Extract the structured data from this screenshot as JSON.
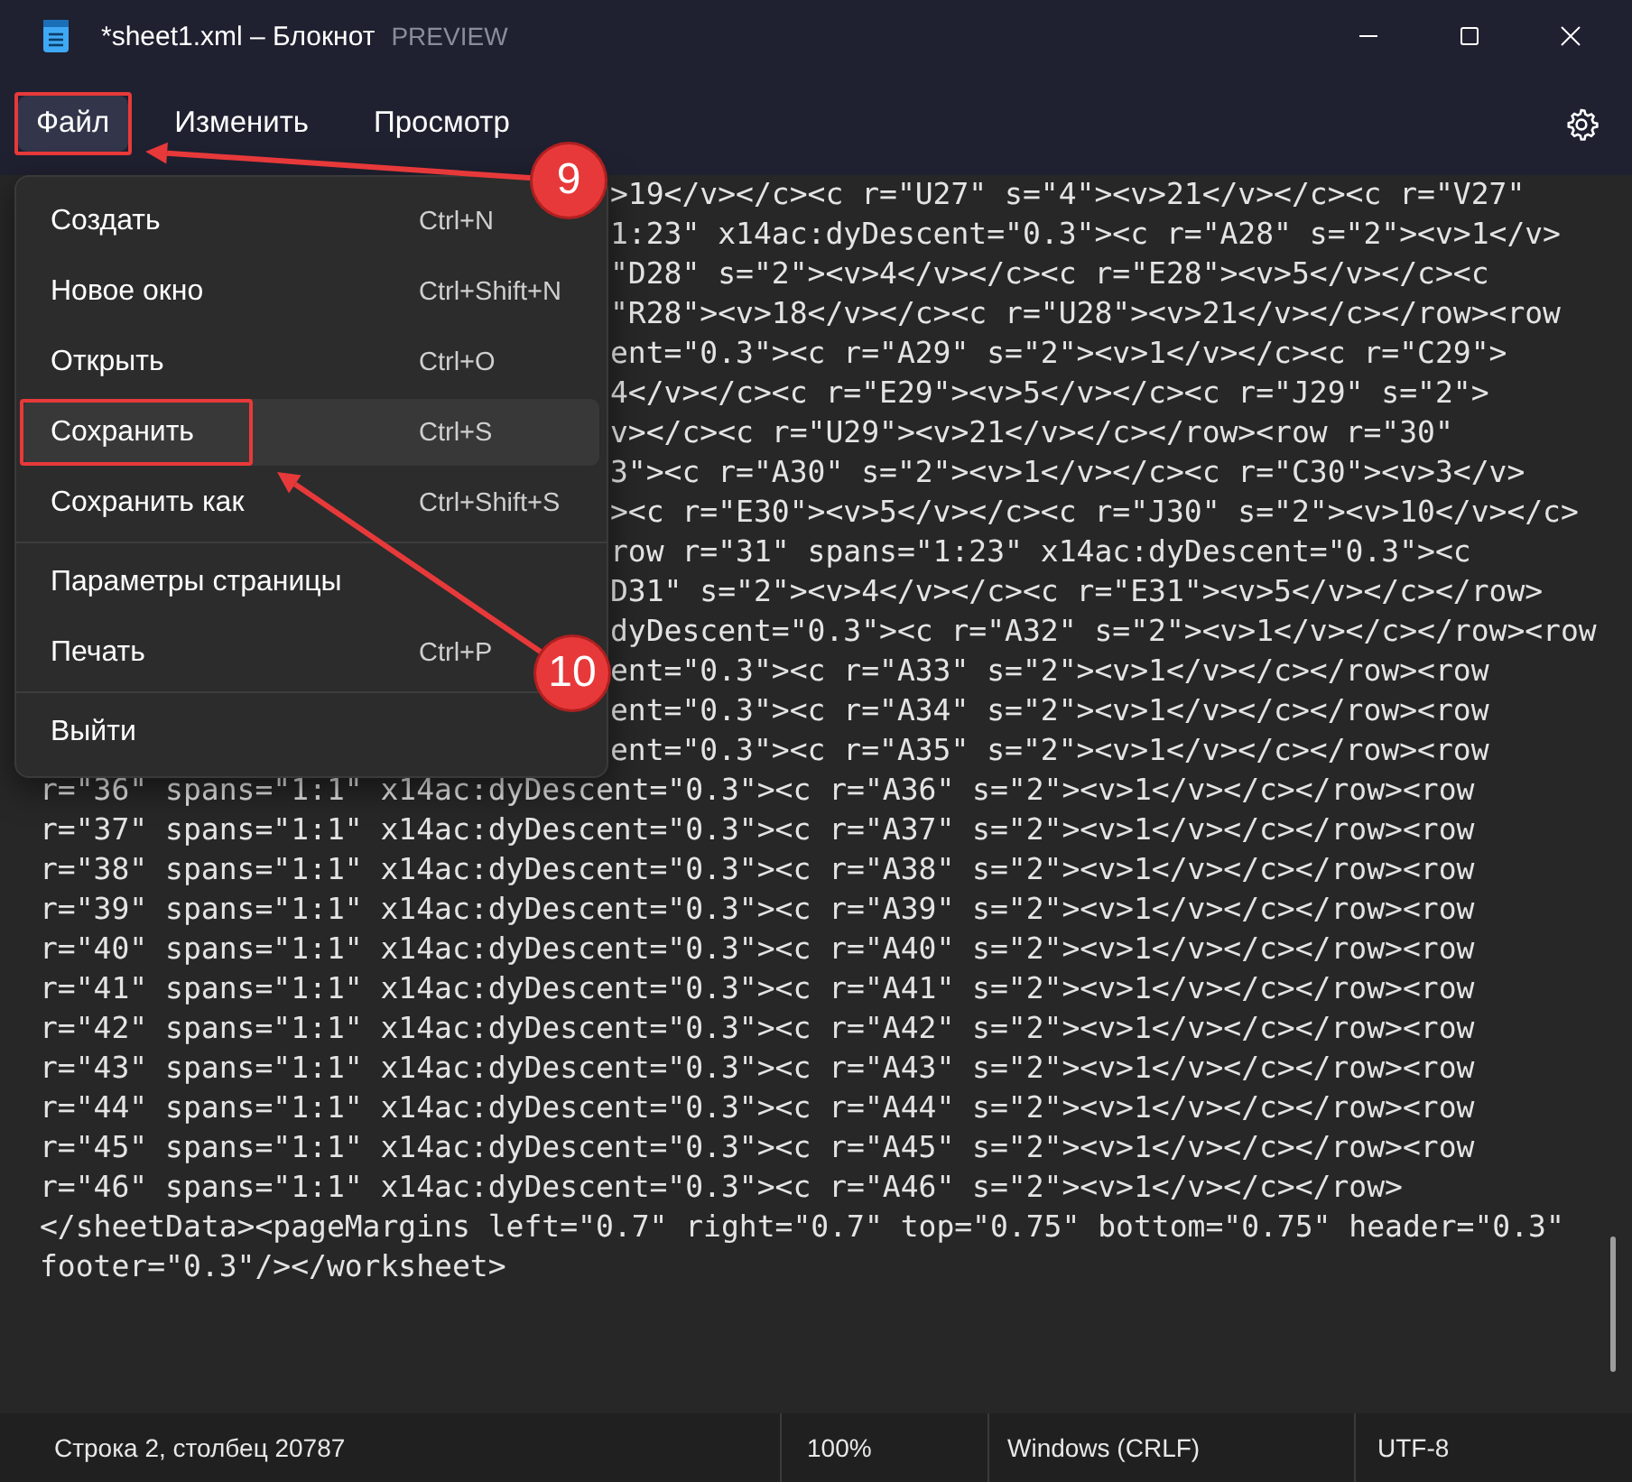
{
  "window": {
    "title": "*sheet1.xml – Блокнот",
    "badge": "PREVIEW"
  },
  "menu_bar": {
    "items": [
      {
        "label": "Файл",
        "selected": true,
        "annotation": "9"
      },
      {
        "label": "Изменить",
        "selected": false
      },
      {
        "label": "Просмотр",
        "selected": false
      }
    ]
  },
  "file_menu": {
    "items": [
      {
        "kind": "item",
        "label": "Создать",
        "shortcut": "Ctrl+N",
        "highlighted": false
      },
      {
        "kind": "item",
        "label": "Новое окно",
        "shortcut": "Ctrl+Shift+N",
        "highlighted": false
      },
      {
        "kind": "item",
        "label": "Открыть",
        "shortcut": "Ctrl+O",
        "highlighted": false
      },
      {
        "kind": "item",
        "label": "Сохранить",
        "shortcut": "Ctrl+S",
        "highlighted": true,
        "annotation": "10"
      },
      {
        "kind": "item",
        "label": "Сохранить как",
        "shortcut": "Ctrl+Shift+S",
        "highlighted": false
      },
      {
        "kind": "separator"
      },
      {
        "kind": "item",
        "label": "Параметры страницы",
        "highlighted": false
      },
      {
        "kind": "item",
        "label": "Печать",
        "shortcut": "Ctrl+P",
        "highlighted": false
      },
      {
        "kind": "separator"
      },
      {
        "kind": "item",
        "label": "Выйти",
        "highlighted": false
      }
    ]
  },
  "editor": {
    "lines_beside_menu": [
      ">19</v></c><c r=\"U27\" s=\"4\"><v>21</v></c><c r=\"V27\"",
      "1:23\" x14ac:dyDescent=\"0.3\"><c r=\"A28\" s=\"2\"><v>1</v>",
      "\"D28\" s=\"2\"><v>4</v></c><c r=\"E28\"><v>5</v></c><c",
      "\"R28\"><v>18</v></c><c r=\"U28\"><v>21</v></c></row><row",
      "ent=\"0.3\"><c r=\"A29\" s=\"2\"><v>1</v></c><c r=\"C29\">",
      "4</v></c><c r=\"E29\"><v>5</v></c><c r=\"J29\" s=\"2\">",
      "v></c><c r=\"U29\"><v>21</v></c></row><row r=\"30\"",
      "3\"><c r=\"A30\" s=\"2\"><v>1</v></c><c r=\"C30\"><v>3</v>",
      "><c r=\"E30\"><v>5</v></c><c r=\"J30\" s=\"2\"><v>10</v></c>",
      "row r=\"31\" spans=\"1:23\" x14ac:dyDescent=\"0.3\"><c",
      "D31\" s=\"2\"><v>4</v></c><c r=\"E31\"><v>5</v></c></row>",
      "dyDescent=\"0.3\"><c r=\"A32\" s=\"2\"><v>1</v></c></row><row",
      "ent=\"0.3\"><c r=\"A33\" s=\"2\"><v>1</v></c></row><row",
      "ent=\"0.3\"><c r=\"A34\" s=\"2\"><v>1</v></c></row><row",
      "ent=\"0.3\"><c r=\"A35\" s=\"2\"><v>1</v></c></row><row"
    ],
    "lines": [
      "r=\"36\" spans=\"1:1\" x14ac:dyDescent=\"0.3\"><c r=\"A36\" s=\"2\"><v>1</v></c></row><row",
      "r=\"37\" spans=\"1:1\" x14ac:dyDescent=\"0.3\"><c r=\"A37\" s=\"2\"><v>1</v></c></row><row",
      "r=\"38\" spans=\"1:1\" x14ac:dyDescent=\"0.3\"><c r=\"A38\" s=\"2\"><v>1</v></c></row><row",
      "r=\"39\" spans=\"1:1\" x14ac:dyDescent=\"0.3\"><c r=\"A39\" s=\"2\"><v>1</v></c></row><row",
      "r=\"40\" spans=\"1:1\" x14ac:dyDescent=\"0.3\"><c r=\"A40\" s=\"2\"><v>1</v></c></row><row",
      "r=\"41\" spans=\"1:1\" x14ac:dyDescent=\"0.3\"><c r=\"A41\" s=\"2\"><v>1</v></c></row><row",
      "r=\"42\" spans=\"1:1\" x14ac:dyDescent=\"0.3\"><c r=\"A42\" s=\"2\"><v>1</v></c></row><row",
      "r=\"43\" spans=\"1:1\" x14ac:dyDescent=\"0.3\"><c r=\"A43\" s=\"2\"><v>1</v></c></row><row",
      "r=\"44\" spans=\"1:1\" x14ac:dyDescent=\"0.3\"><c r=\"A44\" s=\"2\"><v>1</v></c></row><row",
      "r=\"45\" spans=\"1:1\" x14ac:dyDescent=\"0.3\"><c r=\"A45\" s=\"2\"><v>1</v></c></row><row",
      "r=\"46\" spans=\"1:1\" x14ac:dyDescent=\"0.3\"><c r=\"A46\" s=\"2\"><v>1</v></c></row>",
      "</sheetData><pageMargins left=\"0.7\" right=\"0.7\" top=\"0.75\" bottom=\"0.75\" header=\"0.3\"",
      "footer=\"0.3\"/></worksheet>"
    ]
  },
  "status_bar": {
    "position": "Строка 2, столбец 20787",
    "zoom": "100%",
    "line_ending": "Windows (CRLF)",
    "encoding": "UTF-8"
  }
}
